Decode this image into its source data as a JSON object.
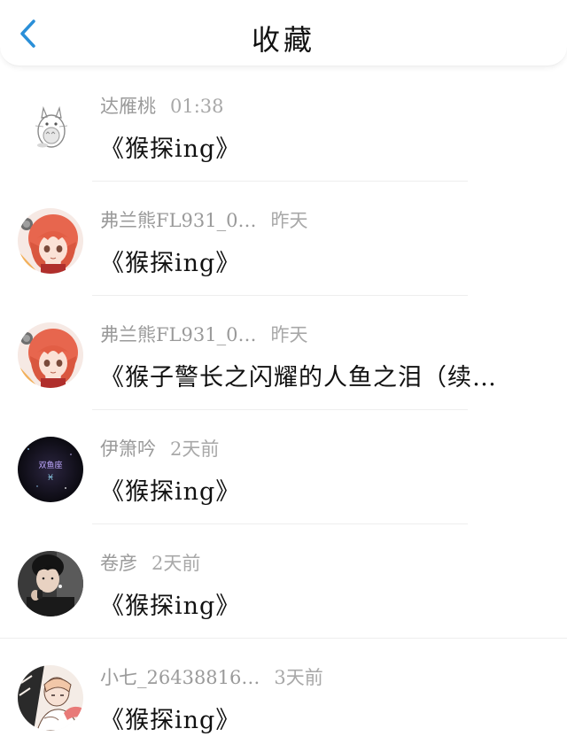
{
  "header": {
    "title": "收藏",
    "back_icon": "chevron-left-icon",
    "accent_color": "#2a8fd8"
  },
  "items": [
    {
      "author": "达雁桃",
      "time": "01:38",
      "title": "《猴探ing》",
      "avatar": "totoro-sketch"
    },
    {
      "author": "弗兰熊FL931_0…",
      "time": "昨天",
      "title": "《猴探ing》",
      "avatar": "anime-red-hair-girl"
    },
    {
      "author": "弗兰熊FL931_0…",
      "time": "昨天",
      "title": "《猴子警长之闪耀的人鱼之泪（续…",
      "avatar": "anime-red-hair-girl"
    },
    {
      "author": "伊箫吟",
      "time": "2天前",
      "title": "《猴探ing》",
      "avatar": "dark-starry",
      "avatar_text": "双鱼座",
      "avatar_symbol": "♓"
    },
    {
      "author": "卷彦",
      "time": "2天前",
      "title": "《猴探ing》",
      "avatar": "singer-photo"
    },
    {
      "author": "小七_26438816…",
      "time": "3天前",
      "title": "《猴探ing》",
      "avatar": "manga-drawing"
    }
  ]
}
